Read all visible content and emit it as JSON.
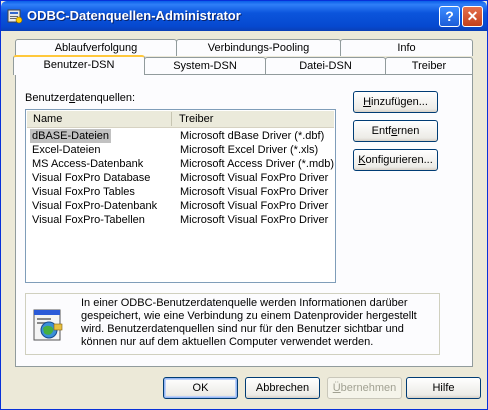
{
  "window": {
    "title": "ODBC-Datenquellen-Administrator"
  },
  "titlebar_buttons": {
    "help": "?",
    "close": "✕"
  },
  "tabs_back": [
    {
      "label": "Ablaufverfolgung"
    },
    {
      "label": "Verbindungs-Pooling"
    },
    {
      "label": "Info"
    }
  ],
  "tabs_front": [
    {
      "label": "Benutzer-DSN"
    },
    {
      "label": "System-DSN"
    },
    {
      "label": "Datei-DSN"
    },
    {
      "label": "Treiber"
    }
  ],
  "list_label": {
    "pre": "Benutzer",
    "accel": "d",
    "post": "atenquellen:"
  },
  "columns": {
    "name": "Name",
    "driver": "Treiber"
  },
  "rows": [
    {
      "name": "dBASE-Dateien",
      "driver": "Microsoft dBase Driver (*.dbf)"
    },
    {
      "name": "Excel-Dateien",
      "driver": "Microsoft Excel Driver (*.xls)"
    },
    {
      "name": "MS Access-Datenbank",
      "driver": "Microsoft Access Driver (*.mdb)"
    },
    {
      "name": "Visual FoxPro Database",
      "driver": "Microsoft Visual FoxPro Driver"
    },
    {
      "name": "Visual FoxPro Tables",
      "driver": "Microsoft Visual FoxPro Driver"
    },
    {
      "name": "Visual FoxPro-Datenbank",
      "driver": "Microsoft Visual FoxPro Driver"
    },
    {
      "name": "Visual FoxPro-Tabellen",
      "driver": "Microsoft Visual FoxPro Driver"
    }
  ],
  "side_buttons": {
    "add": {
      "accel": "H",
      "rest": "inzufügen..."
    },
    "remove": {
      "pre": "Entf",
      "accel": "e",
      "rest": "rnen"
    },
    "configure": {
      "accel": "K",
      "rest": "onfigurieren..."
    }
  },
  "info_text": "In einer ODBC-Benutzerdatenquelle werden Informationen darüber gespeichert, wie eine Verbindung zu einem Datenprovider hergestellt wird. Benutzerdatenquellen sind nur für den Benutzer sichtbar und können nur auf dem aktuellen Computer verwendet werden.",
  "bottom_buttons": {
    "ok": "OK",
    "cancel": "Abbrechen",
    "apply": {
      "accel": "Ü",
      "rest": "bernehmen"
    },
    "help": "Hilfe"
  },
  "colors": {
    "titlebar": "#0b55dc",
    "face": "#ece9d8",
    "tab_highlight": "#ffc83c",
    "selection": "#c1c1c1"
  }
}
